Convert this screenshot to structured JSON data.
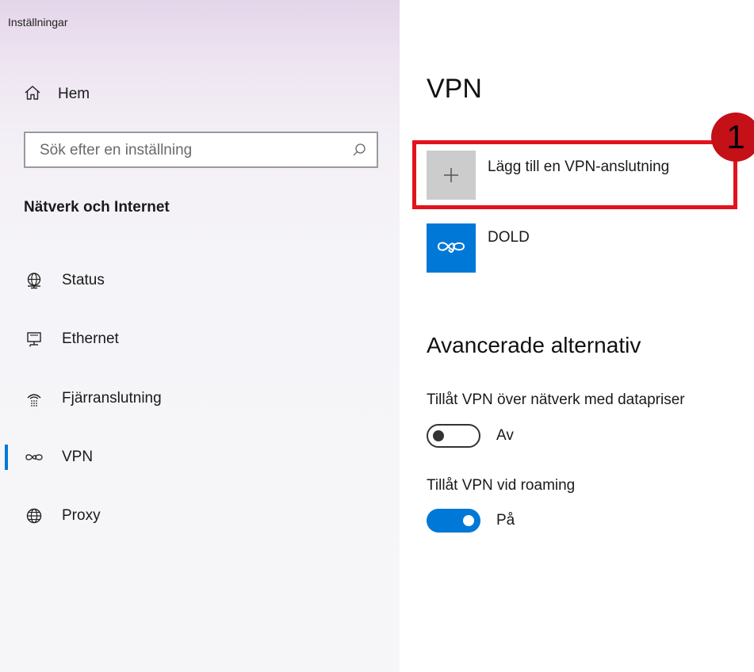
{
  "app": {
    "title": "Inställningar"
  },
  "sidebar": {
    "home_label": "Hem",
    "search": {
      "placeholder": "Sök efter en inställning",
      "value": ""
    },
    "section_title": "Nätverk och Internet",
    "items": [
      {
        "label": "Status",
        "icon": "status-globe-icon"
      },
      {
        "label": "Ethernet",
        "icon": "ethernet-icon"
      },
      {
        "label": "Fjärranslutning",
        "icon": "dialup-icon"
      },
      {
        "label": "VPN",
        "icon": "vpn-icon",
        "selected": true
      },
      {
        "label": "Proxy",
        "icon": "globe-icon"
      }
    ]
  },
  "main": {
    "title": "VPN",
    "add_vpn_label": "Lägg till en VPN-anslutning",
    "annotation_number": "1",
    "connections": [
      {
        "name": "DOLD",
        "icon": "vpn-icon"
      }
    ],
    "advanced_title": "Avancerade alternativ",
    "settings": [
      {
        "label": "Tillåt VPN över nätverk med datapriser",
        "state_label": "Av",
        "on": false
      },
      {
        "label": "Tillåt VPN vid roaming",
        "state_label": "På",
        "on": true
      }
    ]
  },
  "colors": {
    "accent": "#0078d7",
    "highlight": "#e2131b",
    "badge": "#c41017"
  }
}
